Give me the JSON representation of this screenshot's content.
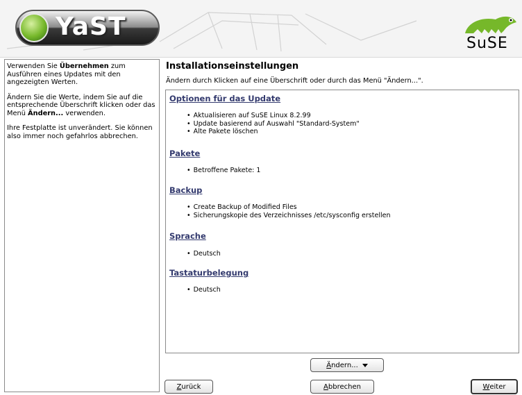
{
  "header": {
    "logo_text": "YaST",
    "brand_text": "SuSE",
    "colors": {
      "logo_green": "#76b82a",
      "brand_green": "#76b82a"
    }
  },
  "help": {
    "p1_pre": "Verwenden Sie ",
    "p1_bold": "Übernehmen",
    "p1_post": " zum Ausführen eines Updates mit den angezeigten Werten.",
    "p2_pre": "Ändern Sie die Werte, indem Sie auf die entsprechende Überschrift klicken oder das Menü ",
    "p2_bold": "Ändern...",
    "p2_post": " verwenden.",
    "p3": "Ihre Festplatte ist unverändert. Sie können also immer noch gefahrlos abbrechen."
  },
  "main": {
    "title": "Installationseinstellungen",
    "subtitle": "Ändern durch Klicken auf eine Überschrift oder durch das Menü \"Ändern...\"."
  },
  "sections": [
    {
      "title": "Optionen für das Update",
      "items": [
        "Aktualisieren auf SuSE Linux 8.2.99",
        "Update basierend auf Auswahl \"Standard-System\"",
        "Alte Pakete löschen"
      ]
    },
    {
      "title": "Pakete",
      "items": [
        "Betroffene Pakete: 1"
      ]
    },
    {
      "title": "Backup",
      "items": [
        "Create Backup of Modified Files",
        "Sicherungskopie des Verzeichnisses /etc/sysconfig erstellen"
      ]
    },
    {
      "title": "Sprache",
      "items": [
        "Deutsch"
      ]
    },
    {
      "title": "Tastaturbelegung",
      "items": [
        "Deutsch"
      ]
    }
  ],
  "buttons": {
    "change_first": "Ä",
    "change_rest": "ndern...",
    "back_first": "Z",
    "back_rest": "urück",
    "abort_first": "A",
    "abort_rest": "bbrechen",
    "next_first": "W",
    "next_rest": "eiter"
  }
}
